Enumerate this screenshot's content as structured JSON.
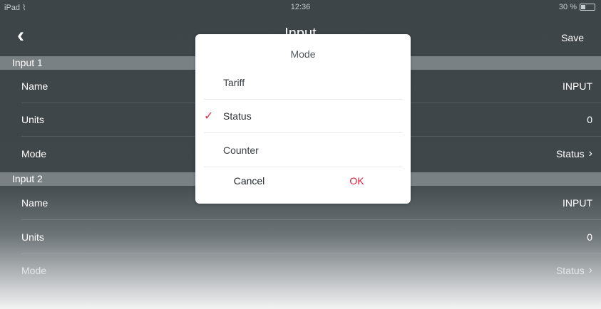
{
  "status_bar": {
    "carrier": "iPad",
    "wifi_icon": "wifi-icon",
    "time": "12:36",
    "battery": "30 %"
  },
  "nav": {
    "title": "Input",
    "save_label": "Save",
    "back_icon": "chevron-left-icon"
  },
  "sections": [
    {
      "header": "Input 1",
      "rows": [
        {
          "label": "Name",
          "value": "INPUT"
        },
        {
          "label": "Units",
          "value": "0"
        },
        {
          "label": "Mode",
          "value": "Status"
        }
      ]
    },
    {
      "header": "Input 2",
      "rows": [
        {
          "label": "Name",
          "value": "INPUT"
        },
        {
          "label": "Units",
          "value": "0"
        },
        {
          "label": "Mode",
          "value": "Status"
        }
      ]
    }
  ],
  "dialog": {
    "title": "Mode",
    "options": [
      {
        "label": "Tariff",
        "selected": false
      },
      {
        "label": "Status",
        "selected": true
      },
      {
        "label": "Counter",
        "selected": false
      }
    ],
    "cancel_label": "Cancel",
    "ok_label": "OK"
  },
  "colors": {
    "accent": "#e0203a",
    "section_header": "#7a8185",
    "background": "#3d4549"
  }
}
